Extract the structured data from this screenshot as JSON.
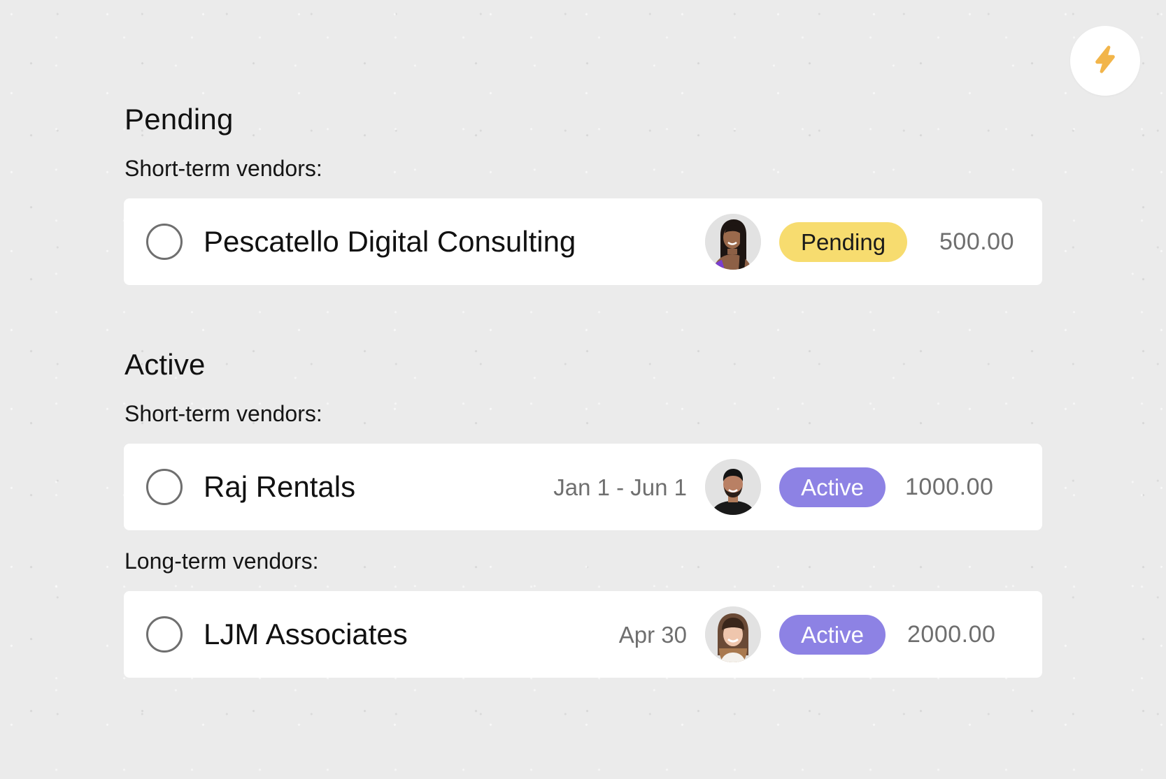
{
  "quick_action": {
    "icon": "lightning-bolt-icon",
    "color": "#f2b54a"
  },
  "sections": [
    {
      "title": "Pending",
      "groups": [
        {
          "label": "Short-term vendors:",
          "vendors": [
            {
              "name": "Pescatello Digital Consulting",
              "date": "",
              "avatar": "woman-long-dark-hair",
              "status": "Pending",
              "amount": "500.00"
            }
          ]
        }
      ]
    },
    {
      "title": "Active",
      "groups": [
        {
          "label": "Short-term vendors:",
          "vendors": [
            {
              "name": "Raj Rentals",
              "date": "Jan 1 - Jun 1",
              "avatar": "man-dark-hair-beard",
              "status": "Active",
              "amount": "1000.00"
            }
          ]
        },
        {
          "label": "Long-term vendors:",
          "vendors": [
            {
              "name": "LJM Associates",
              "date": "Apr 30",
              "avatar": "woman-bangs-brown-hair",
              "status": "Active",
              "amount": "2000.00"
            }
          ]
        }
      ]
    }
  ],
  "status_colors": {
    "Pending": "#f7dc6f",
    "Active": "#8d82e4"
  }
}
